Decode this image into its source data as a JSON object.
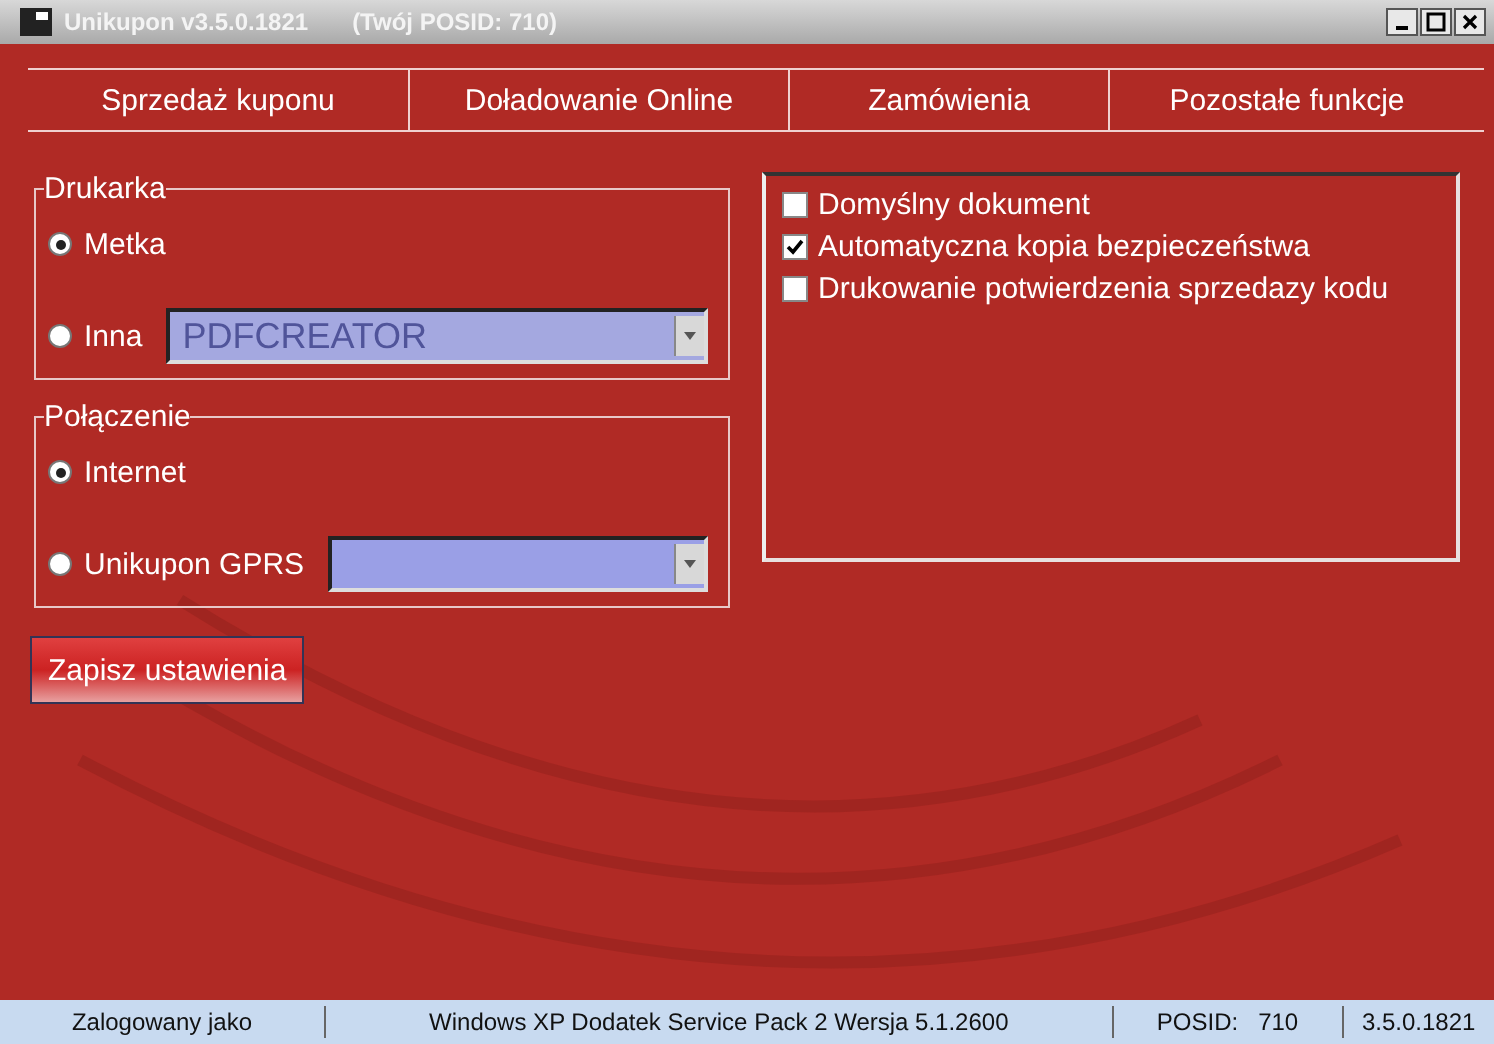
{
  "window": {
    "title": "Unikupon v3.5.0.1821",
    "subtitle": "(Twój POSID: 710)"
  },
  "tabs": [
    {
      "label": "Sprzedaż kuponu",
      "selected": false
    },
    {
      "label": "Doładowanie Online",
      "selected": false
    },
    {
      "label": "Zamówienia",
      "selected": false
    },
    {
      "label": "Pozostałe funkcje",
      "selected": false
    }
  ],
  "printer_group": {
    "title": "Drukarka",
    "options": [
      {
        "label": "Metka",
        "selected": true,
        "kind": "radio"
      },
      {
        "label": "Inna",
        "selected": false,
        "kind": "dropdown",
        "combo": {
          "value": "PDFCREATOR",
          "disabled": true
        }
      }
    ]
  },
  "connection_group": {
    "title": "Połączenie",
    "options": [
      {
        "label": "Internet",
        "selected": true,
        "kind": "radio"
      },
      {
        "label": "Unikupon GPRS",
        "selected": false,
        "kind": "dropdown"
      }
    ]
  },
  "options": [
    {
      "label": "Domyślny dokument",
      "checked": false
    },
    {
      "label": "Automatyczna kopia bezpieczeństwa",
      "checked": true
    },
    {
      "label": "Drukowanie potwierdzenia sprzedazy kodu",
      "checked": false
    }
  ],
  "save_button": "Zapisz ustawienia",
  "status_bar": [
    "Zalogowany jako",
    "Windows XP Dodatek Service Pack 2 Wersja 5.1.2600",
    "POSID:   710",
    "3.5.0.1821"
  ]
}
